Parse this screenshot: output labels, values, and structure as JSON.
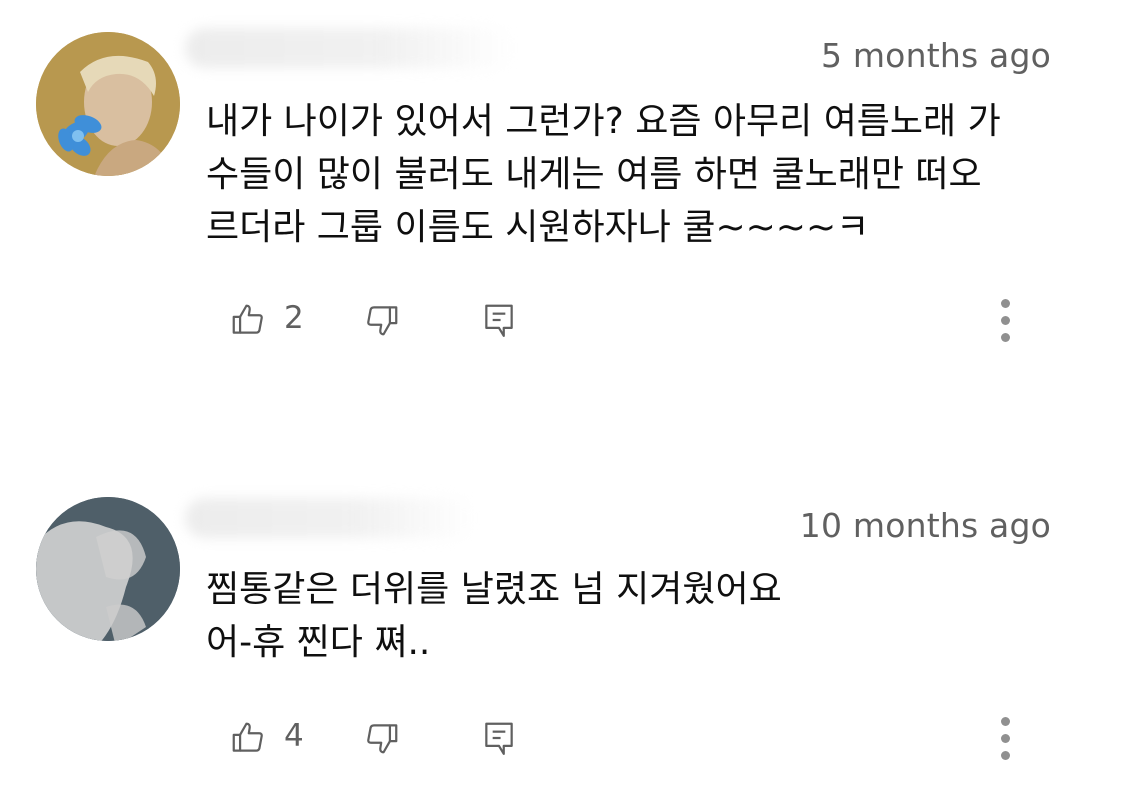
{
  "comments": [
    {
      "time": "5 months ago",
      "lines": [
        "내가 나이가 있어서 그런가? 요즘 아무리 여름노래 가",
        "수들이 많이 불러도 내게는 여름 하면 쿨노래만 떠오",
        "르더라 그룹 이름도 시원하자나 쿨~~~~ㅋ"
      ],
      "likes": "2",
      "avatar_color": "#b99a52"
    },
    {
      "time": "10 months ago",
      "lines": [
        "찜통같은 더위를 날렸죠 넘 지겨웠어요",
        "어-휴 찐다 쪄.."
      ],
      "likes": "4",
      "avatar_color": "#4f5f69"
    }
  ],
  "icons": {
    "like": "thumbs-up-icon",
    "dislike": "thumbs-down-icon",
    "reply": "reply-icon",
    "more": "more-vert-icon"
  }
}
